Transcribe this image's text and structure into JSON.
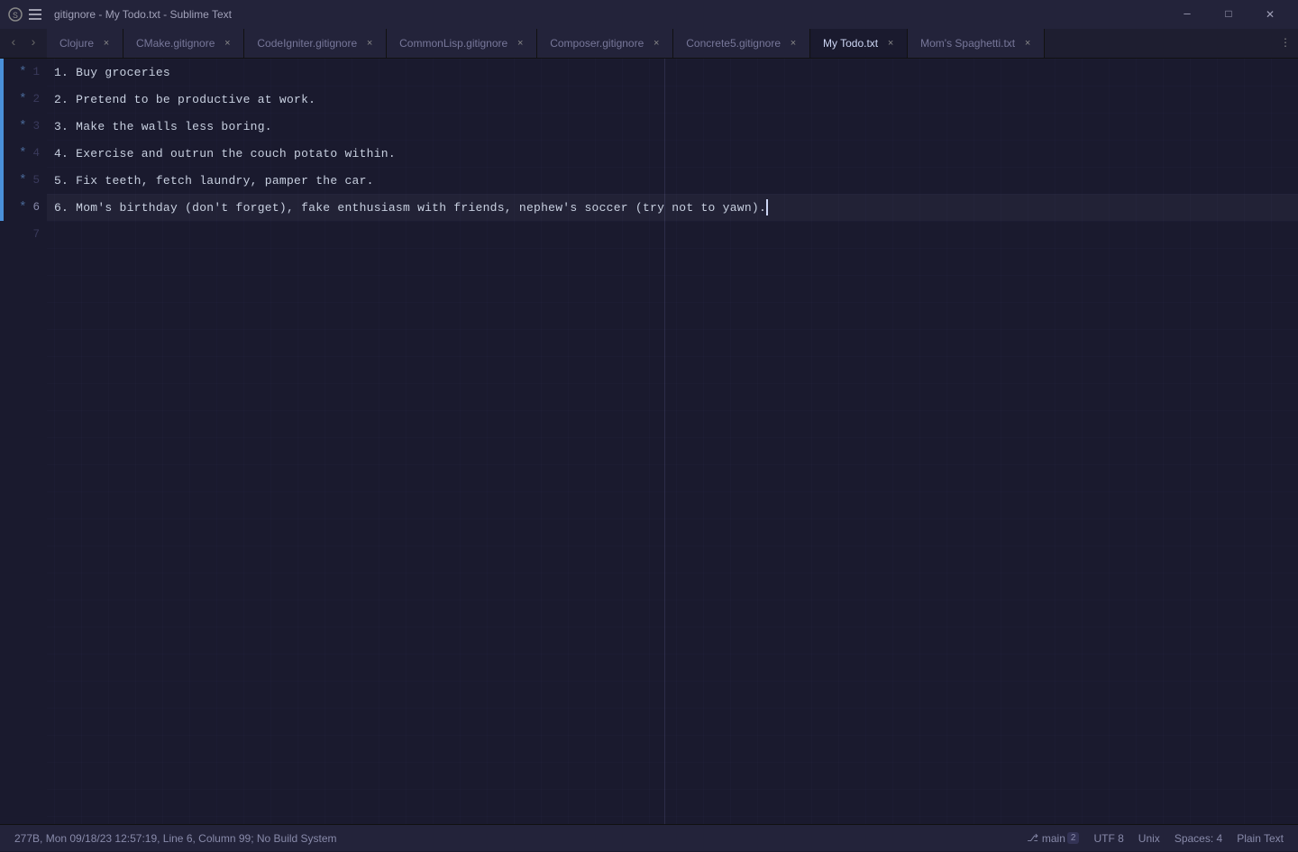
{
  "window": {
    "title": "gitignore - My Todo.txt - Sublime Text",
    "icon": "◆"
  },
  "window_controls": {
    "minimize": "─",
    "maximize": "□",
    "close": "✕"
  },
  "nav": {
    "back": "‹",
    "forward": "›"
  },
  "tabs": [
    {
      "id": "clojure",
      "label": "Clojure",
      "modified": false,
      "active": false
    },
    {
      "id": "cmake",
      "label": "CMake.gitignore",
      "modified": false,
      "active": false
    },
    {
      "id": "codeigniter",
      "label": "CodeIgniter.gitignore",
      "modified": false,
      "active": false
    },
    {
      "id": "commonlisp",
      "label": "CommonLisp.gitignore",
      "modified": false,
      "active": false
    },
    {
      "id": "composer",
      "label": "Composer.gitignore",
      "modified": false,
      "active": false
    },
    {
      "id": "concrete5",
      "label": "Concrete5.gitignore",
      "modified": false,
      "active": false
    },
    {
      "id": "mytodo",
      "label": "My Todo.txt",
      "modified": false,
      "active": true
    },
    {
      "id": "momspaghetti",
      "label": "Mom's Spaghetti.txt",
      "modified": false,
      "active": false
    }
  ],
  "editor": {
    "lines": [
      {
        "num": 1,
        "text": "1. Buy groceries",
        "modified": true,
        "active": false
      },
      {
        "num": 2,
        "text": "2. Pretend to be productive at work.",
        "modified": true,
        "active": false
      },
      {
        "num": 3,
        "text": "3. Make the walls less boring.",
        "modified": true,
        "active": false
      },
      {
        "num": 4,
        "text": "4. Exercise and outrun the couch potato within.",
        "modified": true,
        "active": false
      },
      {
        "num": 5,
        "text": "5. Fix teeth, fetch laundry, pamper the car.",
        "modified": true,
        "active": false
      },
      {
        "num": 6,
        "text": "6. Mom's birthday (don't forget), fake enthusiasm with friends, nephew's soccer (try not to yawn).",
        "modified": true,
        "active": true
      },
      {
        "num": 7,
        "text": "",
        "modified": false,
        "active": false
      }
    ]
  },
  "status_bar": {
    "file_info": "277B, Mon 09/18/23 12:57:19, Line 6, Column 99; No Build System",
    "branch": "main",
    "branch_count": "2",
    "encoding": "UTF 8",
    "line_ending": "Unix",
    "indent": "Spaces: 4",
    "syntax": "Plain Text"
  }
}
